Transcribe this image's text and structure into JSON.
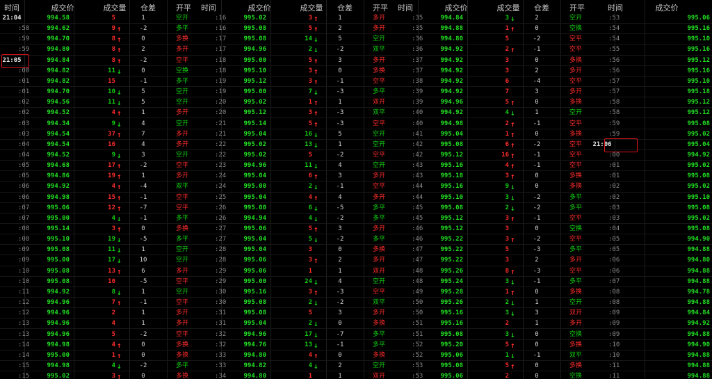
{
  "columns": [
    "时间",
    "成交价",
    "成交量",
    "仓差",
    "开平"
  ],
  "colors": {
    "up": "#ff2d2d",
    "down": "#12d112",
    "price": "#23e023"
  },
  "panels": [
    {
      "rows": [
        [
          "21:04",
          "994.58",
          "5",
          "",
          "1",
          "空开"
        ],
        [
          ":58",
          "994.62",
          "9",
          "u",
          "-2",
          "多平"
        ],
        [
          ":59",
          "994.70",
          "8",
          "u",
          "0",
          "多换"
        ],
        [
          ":59",
          "994.80",
          "8",
          "u",
          "2",
          "多开"
        ],
        [
          "21:05",
          "994.84",
          "8",
          "u",
          "-2",
          "空平"
        ],
        [
          ":00",
          "994.82",
          "11",
          "d",
          "0",
          "空换"
        ],
        [
          ":01",
          "994.82",
          "15",
          "",
          "-1",
          "多平"
        ],
        [
          ":01",
          "994.70",
          "10",
          "d",
          "5",
          "空开"
        ],
        [
          ":02",
          "994.56",
          "11",
          "d",
          "5",
          "空开"
        ],
        [
          ":02",
          "994.52",
          "4",
          "u",
          "1",
          "多开"
        ],
        [
          ":03",
          "994.34",
          "9",
          "d",
          "4",
          "空开"
        ],
        [
          ":03",
          "994.54",
          "37",
          "u",
          "7",
          "多开"
        ],
        [
          ":04",
          "994.54",
          "16",
          "",
          "4",
          "多开"
        ],
        [
          ":04",
          "994.52",
          "9",
          "d",
          "3",
          "空开"
        ],
        [
          ":05",
          "994.68",
          "17",
          "u",
          "-2",
          "空平"
        ],
        [
          ":05",
          "994.86",
          "19",
          "u",
          "1",
          "多开"
        ],
        [
          ":06",
          "994.92",
          "4",
          "u",
          "-4",
          "双平"
        ],
        [
          ":06",
          "994.98",
          "15",
          "u",
          "-1",
          "空平"
        ],
        [
          ":07",
          "995.06",
          "12",
          "u",
          "-7",
          "空平"
        ],
        [
          ":07",
          "995.00",
          "4",
          "d",
          "-1",
          "多平"
        ],
        [
          ":08",
          "995.14",
          "3",
          "u",
          "0",
          "多换"
        ],
        [
          ":08",
          "995.10",
          "19",
          "d",
          "-5",
          "多平"
        ],
        [
          ":09",
          "995.08",
          "11",
          "d",
          "1",
          "空开"
        ],
        [
          ":09",
          "995.00",
          "17",
          "d",
          "10",
          "空开"
        ],
        [
          ":10",
          "995.08",
          "13",
          "u",
          "6",
          "多开"
        ],
        [
          ":10",
          "995.08",
          "10",
          "",
          "-5",
          "空平"
        ],
        [
          ":11",
          "994.92",
          "8",
          "d",
          "1",
          "空开"
        ],
        [
          ":12",
          "994.96",
          "7",
          "u",
          "-1",
          "空平"
        ],
        [
          ":12",
          "994.96",
          "2",
          "",
          "1",
          "多开"
        ],
        [
          ":13",
          "994.96",
          "4",
          "",
          "1",
          "多开"
        ],
        [
          ":13",
          "994.96",
          "5",
          "",
          "-2",
          "空平"
        ],
        [
          ":14",
          "994.98",
          "4",
          "u",
          "0",
          "多换"
        ],
        [
          ":14",
          "995.00",
          "1",
          "u",
          "0",
          "多换"
        ],
        [
          ":15",
          "994.98",
          "4",
          "d",
          "-2",
          "多平"
        ],
        [
          ":15",
          "995.02",
          "3",
          "u",
          "0",
          "多换"
        ]
      ]
    },
    {
      "rows": [
        [
          ":16",
          "995.02",
          "3",
          "u",
          "1",
          "多开"
        ],
        [
          ":16",
          "995.08",
          "5",
          "u",
          "2",
          "多开"
        ],
        [
          ":17",
          "995.08",
          "14",
          "d",
          "5",
          "空开"
        ],
        [
          ":17",
          "994.96",
          "2",
          "d",
          "-2",
          "双平"
        ],
        [
          ":18",
          "995.00",
          "5",
          "u",
          "3",
          "多开"
        ],
        [
          ":18",
          "995.10",
          "3",
          "u",
          "0",
          "多换"
        ],
        [
          ":19",
          "995.12",
          "3",
          "u",
          "-1",
          "空平"
        ],
        [
          ":19",
          "995.00",
          "7",
          "d",
          "-3",
          "多平"
        ],
        [
          ":20",
          "995.02",
          "1",
          "u",
          "1",
          "双开"
        ],
        [
          ":20",
          "995.12",
          "3",
          "u",
          "-3",
          "双平"
        ],
        [
          ":21",
          "995.14",
          "5",
          "u",
          "-3",
          "空平"
        ],
        [
          ":21",
          "995.04",
          "16",
          "d",
          "5",
          "空开"
        ],
        [
          ":22",
          "995.02",
          "13",
          "d",
          "1",
          "空开"
        ],
        [
          ":22",
          "995.02",
          "5",
          "",
          "-2",
          "空平"
        ],
        [
          ":23",
          "994.96",
          "11",
          "d",
          "4",
          "空开"
        ],
        [
          ":24",
          "995.04",
          "6",
          "u",
          "3",
          "多开"
        ],
        [
          ":24",
          "995.00",
          "2",
          "d",
          "-1",
          "空平"
        ],
        [
          ":25",
          "995.04",
          "4",
          "u",
          "4",
          "多开"
        ],
        [
          ":26",
          "995.00",
          "6",
          "d",
          "-5",
          "多平"
        ],
        [
          ":26",
          "994.94",
          "4",
          "d",
          "-2",
          "多平"
        ],
        [
          ":27",
          "995.06",
          "5",
          "u",
          "3",
          "多开"
        ],
        [
          ":27",
          "995.04",
          "5",
          "d",
          "-2",
          "多平"
        ],
        [
          ":28",
          "995.04",
          "3",
          "",
          "0",
          "多换"
        ],
        [
          ":28",
          "995.06",
          "3",
          "u",
          "2",
          "多开"
        ],
        [
          ":29",
          "995.06",
          "1",
          "",
          "1",
          "双开"
        ],
        [
          ":29",
          "995.00",
          "24",
          "d",
          "4",
          "空开"
        ],
        [
          ":30",
          "995.16",
          "3",
          "u",
          "-3",
          "空平"
        ],
        [
          ":30",
          "995.08",
          "2",
          "d",
          "-2",
          "双平"
        ],
        [
          ":31",
          "995.08",
          "5",
          "",
          "3",
          "多开"
        ],
        [
          ":31",
          "995.04",
          "2",
          "d",
          "0",
          "多换"
        ],
        [
          ":32",
          "994.96",
          "17",
          "d",
          "-7",
          "多平"
        ],
        [
          ":32",
          "994.76",
          "13",
          "d",
          "-1",
          "多平"
        ],
        [
          ":33",
          "994.80",
          "4",
          "u",
          "0",
          "多换"
        ],
        [
          ":33",
          "994.82",
          "4",
          "d",
          "2",
          "空开"
        ],
        [
          ":34",
          "994.80",
          "1",
          "",
          "1",
          "双开"
        ]
      ]
    },
    {
      "rows": [
        [
          ":35",
          "994.84",
          "3",
          "d",
          "2",
          "空开"
        ],
        [
          ":35",
          "994.88",
          "1",
          "u",
          "0",
          "空换"
        ],
        [
          ":36",
          "994.80",
          "5",
          "",
          "-2",
          "空平"
        ],
        [
          ":36",
          "994.92",
          "2",
          "u",
          "-1",
          "空平"
        ],
        [
          ":37",
          "994.92",
          "3",
          "",
          "0",
          "多换"
        ],
        [
          ":37",
          "994.92",
          "3",
          "",
          "2",
          "多开"
        ],
        [
          ":38",
          "994.92",
          "6",
          "",
          "-4",
          "空平"
        ],
        [
          ":39",
          "994.92",
          "7",
          "",
          "3",
          "多开"
        ],
        [
          ":39",
          "994.96",
          "5",
          "u",
          "0",
          "多换"
        ],
        [
          ":40",
          "994.92",
          "4",
          "d",
          "1",
          "空开"
        ],
        [
          ":40",
          "994.98",
          "2",
          "u",
          "-1",
          "空平"
        ],
        [
          ":41",
          "995.04",
          "1",
          "u",
          "0",
          "多换"
        ],
        [
          ":42",
          "995.08",
          "6",
          "u",
          "-2",
          "空平"
        ],
        [
          ":42",
          "995.12",
          "16",
          "u",
          "-1",
          "空平"
        ],
        [
          ":43",
          "995.16",
          "4",
          "u",
          "-1",
          "空平"
        ],
        [
          ":43",
          "995.18",
          "3",
          "u",
          "0",
          "多换"
        ],
        [
          ":44",
          "995.16",
          "9",
          "d",
          "0",
          "多换"
        ],
        [
          ":44",
          "995.10",
          "3",
          "d",
          "-2",
          "多平"
        ],
        [
          ":45",
          "995.08",
          "2",
          "d",
          "-2",
          "多平"
        ],
        [
          ":45",
          "995.12",
          "3",
          "u",
          "-1",
          "空平"
        ],
        [
          ":46",
          "995.12",
          "3",
          "",
          "0",
          "空换"
        ],
        [
          ":46",
          "995.22",
          "3",
          "u",
          "-2",
          "空平"
        ],
        [
          ":47",
          "995.22",
          "5",
          "",
          "-3",
          "多平"
        ],
        [
          ":47",
          "995.22",
          "3",
          "",
          "2",
          "多开"
        ],
        [
          ":48",
          "995.26",
          "8",
          "u",
          "-3",
          "空平"
        ],
        [
          ":48",
          "995.24",
          "3",
          "d",
          "-1",
          "多平"
        ],
        [
          ":49",
          "995.28",
          "1",
          "u",
          "0",
          "多换"
        ],
        [
          ":50",
          "995.26",
          "2",
          "d",
          "1",
          "空开"
        ],
        [
          ":50",
          "995.16",
          "3",
          "d",
          "3",
          "双开"
        ],
        [
          ":51",
          "995.16",
          "2",
          "",
          "1",
          "多开"
        ],
        [
          ":51",
          "995.08",
          "3",
          "d",
          "0",
          "空换"
        ],
        [
          ":52",
          "995.20",
          "5",
          "u",
          "0",
          "多换"
        ],
        [
          ":52",
          "995.06",
          "1",
          "d",
          "-1",
          "双平"
        ],
        [
          ":53",
          "995.08",
          "5",
          "u",
          "0",
          "多换"
        ],
        [
          ":53",
          "995.06",
          "2",
          "",
          "0",
          "空换"
        ]
      ]
    },
    {
      "rows": [
        [
          ":53",
          "995.06",
          "",
          ""
        ],
        [
          ":54",
          "995.16",
          "",
          ""
        ],
        [
          ":54",
          "995.10",
          "",
          ""
        ],
        [
          ":55",
          "995.16",
          "",
          ""
        ],
        [
          ":56",
          "995.12",
          "",
          ""
        ],
        [
          ":56",
          "995.16",
          "",
          ""
        ],
        [
          ":57",
          "995.10",
          "",
          ""
        ],
        [
          ":57",
          "995.18",
          "",
          ""
        ],
        [
          ":58",
          "995.12",
          "",
          ""
        ],
        [
          ":58",
          "995.12",
          "",
          ""
        ],
        [
          ":59",
          "995.08",
          "",
          ""
        ],
        [
          ":59",
          "995.02",
          "",
          ""
        ],
        [
          "21:06",
          "995.04",
          "",
          ""
        ],
        [
          ":00",
          "994.92",
          "",
          ""
        ],
        [
          ":01",
          "995.02",
          "",
          ""
        ],
        [
          ":01",
          "995.08",
          "",
          ""
        ],
        [
          ":02",
          "995.02",
          "",
          ""
        ],
        [
          ":02",
          "995.10",
          "",
          ""
        ],
        [
          ":03",
          "995.08",
          "",
          ""
        ],
        [
          ":03",
          "995.02",
          "",
          ""
        ],
        [
          ":04",
          "995.08",
          "",
          ""
        ],
        [
          ":05",
          "994.90",
          "",
          ""
        ],
        [
          ":05",
          "994.88",
          "",
          ""
        ],
        [
          ":06",
          "994.80",
          "",
          ""
        ],
        [
          ":06",
          "994.88",
          "",
          ""
        ],
        [
          ":07",
          "994.88",
          "",
          ""
        ],
        [
          ":08",
          "994.78",
          "",
          ""
        ],
        [
          ":08",
          "994.88",
          "",
          ""
        ],
        [
          ":09",
          "994.84",
          "",
          ""
        ],
        [
          ":09",
          "994.92",
          "",
          ""
        ],
        [
          ":09",
          "994.88",
          "",
          ""
        ],
        [
          ":10",
          "994.90",
          "",
          ""
        ],
        [
          ":10",
          "994.88",
          "",
          ""
        ],
        [
          ":11",
          "994.88",
          "",
          ""
        ],
        [
          ":11",
          "994.88",
          "",
          ""
        ]
      ]
    }
  ],
  "highlights": [
    "21:05",
    "21:06"
  ]
}
